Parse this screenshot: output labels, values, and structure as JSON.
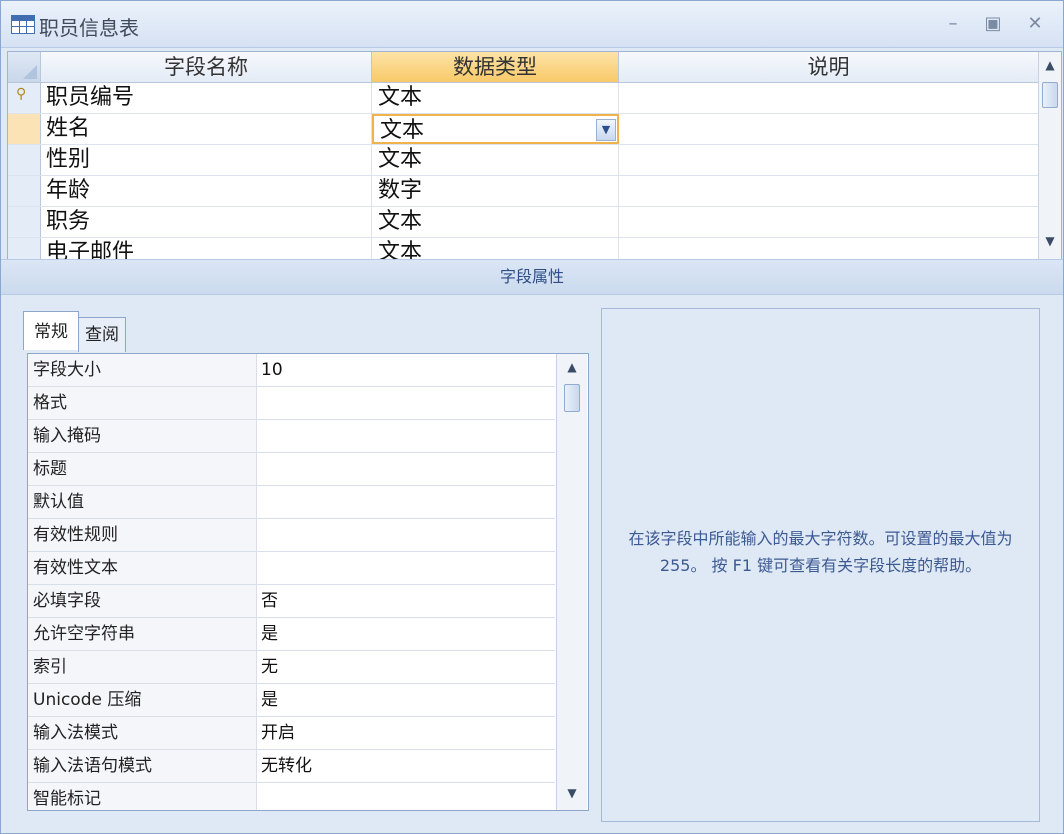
{
  "window": {
    "title": "职员信息表"
  },
  "grid": {
    "headers": [
      "字段名称",
      "数据类型",
      "说明"
    ],
    "rows": [
      {
        "name": "职员编号",
        "type": "文本",
        "primary_key": true
      },
      {
        "name": "姓名",
        "type": "文本",
        "current": true
      },
      {
        "name": "性别",
        "type": "文本"
      },
      {
        "name": "年龄",
        "type": "数字"
      },
      {
        "name": "职务",
        "type": "文本"
      },
      {
        "name": "电子邮件",
        "type": "文本"
      }
    ]
  },
  "section_title": "字段属性",
  "tabs": [
    {
      "label": "常规",
      "active": true
    },
    {
      "label": "查阅",
      "active": false
    }
  ],
  "properties": [
    {
      "label": "字段大小",
      "value": "10"
    },
    {
      "label": "格式",
      "value": ""
    },
    {
      "label": "输入掩码",
      "value": ""
    },
    {
      "label": "标题",
      "value": ""
    },
    {
      "label": "默认值",
      "value": ""
    },
    {
      "label": "有效性规则",
      "value": ""
    },
    {
      "label": "有效性文本",
      "value": ""
    },
    {
      "label": "必填字段",
      "value": "否"
    },
    {
      "label": "允许空字符串",
      "value": "是"
    },
    {
      "label": "索引",
      "value": "无"
    },
    {
      "label": "Unicode 压缩",
      "value": "是"
    },
    {
      "label": "输入法模式",
      "value": "开启"
    },
    {
      "label": "输入法语句模式",
      "value": "无转化"
    },
    {
      "label": "智能标记",
      "value": ""
    }
  ],
  "help_text": "在该字段中所能输入的最大字符数。可设置的最大值为 255。 按 F1 键可查看有关字段长度的帮助。",
  "colors": {
    "accent": "#f8c968",
    "header": "#dfe8f5",
    "help_text": "#3c5a92"
  }
}
